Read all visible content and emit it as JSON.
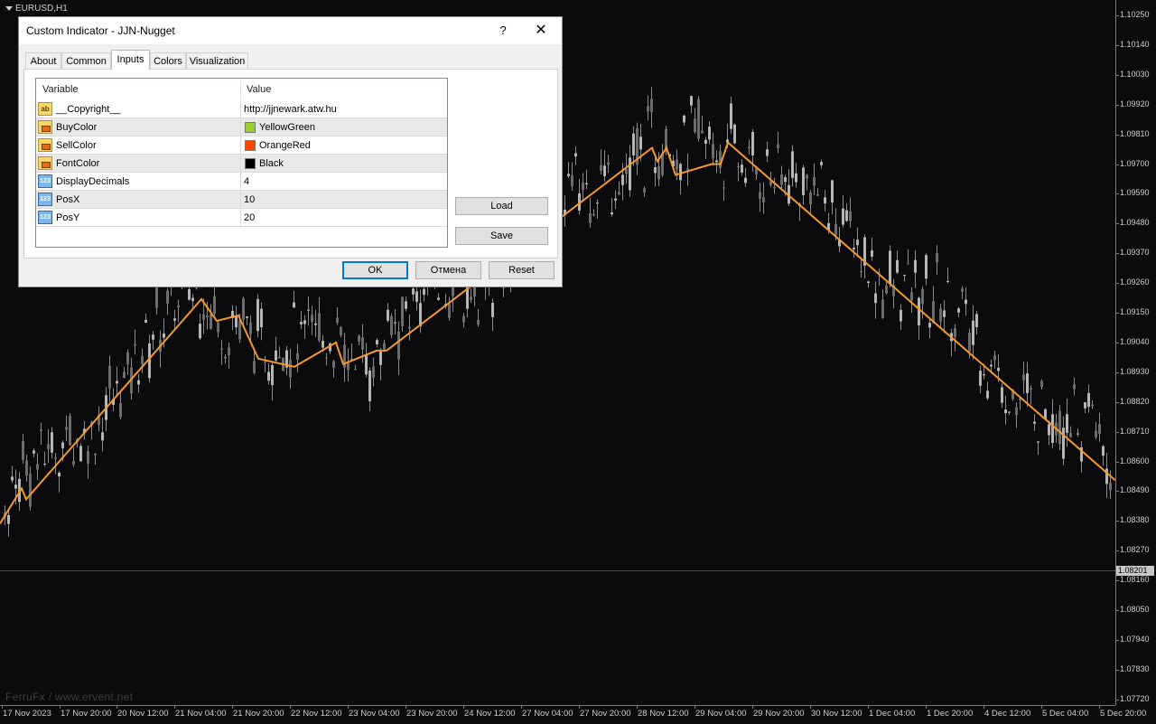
{
  "chart": {
    "symbol": "EURUSD,H1",
    "watermark": "FerruFx / www.ervent.net",
    "current_price": "1.08201",
    "price_ticks": [
      "1.10250",
      "1.10140",
      "1.10030",
      "1.09920",
      "1.09810",
      "1.09700",
      "1.09590",
      "1.09480",
      "1.09370",
      "1.09260",
      "1.09150",
      "1.09040",
      "1.08930",
      "1.08820",
      "1.08710",
      "1.08600",
      "1.08490",
      "1.08380",
      "1.08270",
      "1.08160",
      "1.08050",
      "1.07940",
      "1.07830",
      "1.07720"
    ],
    "time_ticks": [
      "17 Nov 2023",
      "17 Nov 20:00",
      "20 Nov 12:00",
      "21 Nov 04:00",
      "21 Nov 20:00",
      "22 Nov 12:00",
      "23 Nov 04:00",
      "23 Nov 20:00",
      "24 Nov 12:00",
      "27 Nov 04:00",
      "27 Nov 20:00",
      "28 Nov 12:00",
      "29 Nov 04:00",
      "29 Nov 20:00",
      "30 Nov 12:00",
      "1 Dec 04:00",
      "1 Dec 20:00",
      "4 Dec 12:00",
      "5 Dec 04:00",
      "5 Dec 20:00"
    ],
    "colors": {
      "background": "#0b0b0d",
      "candles": "#8c8c8c",
      "zigzag": "#f39a2b",
      "axis": "#7a7a7a"
    },
    "zigzag": [
      {
        "t": 0,
        "p": 1.0837
      },
      {
        "t": 24,
        "p": 1.085
      },
      {
        "t": 29,
        "p": 1.0846
      },
      {
        "t": 223,
        "p": 1.092
      },
      {
        "t": 240,
        "p": 1.0912
      },
      {
        "t": 264,
        "p": 1.0914
      },
      {
        "t": 286,
        "p": 1.0898
      },
      {
        "t": 326,
        "p": 1.0895
      },
      {
        "t": 372,
        "p": 1.0904
      },
      {
        "t": 380,
        "p": 1.0896
      },
      {
        "t": 417,
        "p": 1.0901
      },
      {
        "t": 428,
        "p": 1.0901
      },
      {
        "t": 722,
        "p": 1.0976
      },
      {
        "t": 728,
        "p": 1.0971
      },
      {
        "t": 738,
        "p": 1.0976
      },
      {
        "t": 748,
        "p": 1.0966
      },
      {
        "t": 788,
        "p": 1.097
      },
      {
        "t": 798,
        "p": 1.097
      },
      {
        "t": 806,
        "p": 1.0978
      },
      {
        "t": 1235,
        "p": 1.0853
      }
    ]
  },
  "dialog": {
    "title": "Custom Indicator - JJN-Nugget",
    "help": "?",
    "close": "✕",
    "tabs": [
      "About",
      "Common",
      "Inputs",
      "Colors",
      "Visualization"
    ],
    "active_tab": "Inputs",
    "columns": {
      "variable": "Variable",
      "value": "Value"
    },
    "rows": [
      {
        "icon": "text-icon",
        "variable": "__Copyright__",
        "value": "http://jjnewark.atw.hu"
      },
      {
        "icon": "color-icon",
        "variable": "BuyColor",
        "value": "YellowGreen",
        "swatch": "#9acd32"
      },
      {
        "icon": "color-icon",
        "variable": "SellColor",
        "value": "OrangeRed",
        "swatch": "#ff4500"
      },
      {
        "icon": "color-icon",
        "variable": "FontColor",
        "value": "Black",
        "swatch": "#000000"
      },
      {
        "icon": "number-icon",
        "variable": "DisplayDecimals",
        "value": "4"
      },
      {
        "icon": "number-icon",
        "variable": "PosX",
        "value": "10"
      },
      {
        "icon": "number-icon",
        "variable": "PosY",
        "value": "20"
      }
    ],
    "buttons": {
      "load": "Load",
      "save": "Save",
      "ok": "OK",
      "cancel": "Отмена",
      "reset": "Reset"
    }
  }
}
